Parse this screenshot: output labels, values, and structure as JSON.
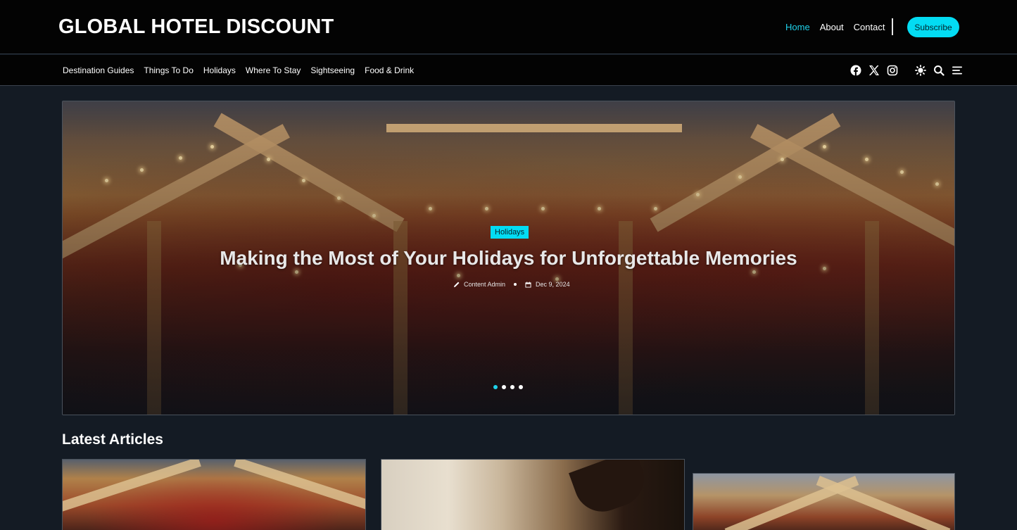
{
  "header": {
    "logo": "GLOBAL HOTEL DISCOUNT",
    "nav": [
      "Home",
      "About",
      "Contact"
    ],
    "active_nav": "Home",
    "subscribe_label": "Subscribe"
  },
  "categories": [
    "Destination Guides",
    "Things To Do",
    "Holidays",
    "Where To Stay",
    "Sightseeing",
    "Food & Drink"
  ],
  "icons": {
    "social": [
      "facebook-icon",
      "x-icon",
      "instagram-icon"
    ],
    "tools": [
      "theme-toggle-icon",
      "search-icon",
      "menu-icon"
    ]
  },
  "hero": {
    "category": "Holidays",
    "title": "Making the Most of Your Holidays for Unforgettable Memories",
    "author": "Content Admin",
    "date": "Dec 9, 2024",
    "slides": 4,
    "active_slide": 1
  },
  "latest": {
    "heading": "Latest Articles"
  },
  "colors": {
    "accent": "#03dcf3",
    "header_bg": "#030303",
    "page_bg": "#141b24"
  }
}
